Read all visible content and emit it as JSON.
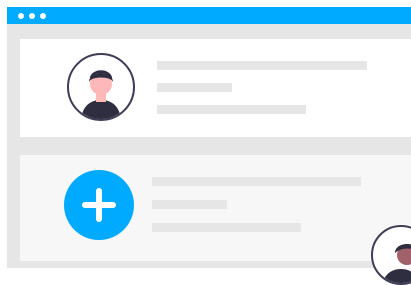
{
  "window": {
    "titlebar_color": "#00aaff",
    "titlebar_dots": [
      "dot",
      "dot",
      "dot"
    ]
  },
  "cards": [
    {
      "icon": "user-avatar-icon",
      "icon_color": "#3f3d56",
      "skin_color": "#ffb8b8",
      "hair_color": "#2f2e41"
    },
    {
      "icon": "plus-icon",
      "icon_color": "#00aaff"
    }
  ],
  "colors": {
    "accent": "#00aaff",
    "panel_background": "#e6e6e6",
    "card_background": "#ffffff",
    "placeholder_line": "#e6e6e6",
    "outline": "#3f3d56"
  },
  "corner_avatar": {
    "icon": "user-avatar-icon",
    "skin_color": "#a0616a",
    "hair_color": "#2f2e41"
  }
}
